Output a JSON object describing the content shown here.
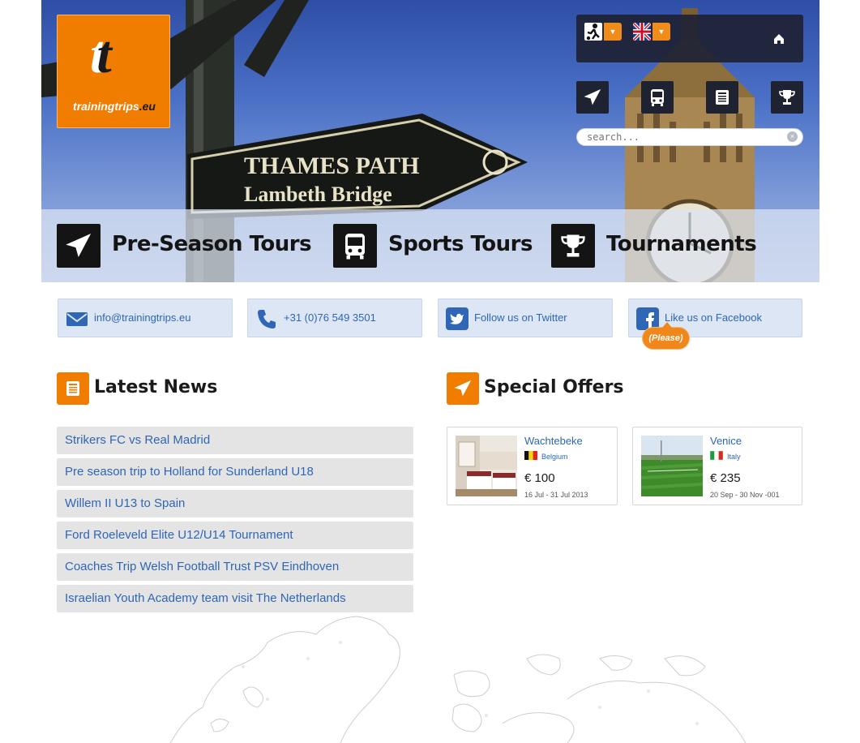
{
  "logo": {
    "mark_first": "t",
    "mark_second": "t",
    "name_prefix": "training",
    "name_accent": "trips",
    "name_suffix": ".eu"
  },
  "header": {
    "sport_selector": {
      "icon": "footballer-icon"
    },
    "language_selector": {
      "icon": "uk-flag-icon"
    },
    "home_icon": "home-icon",
    "nav_tiles": [
      "airplane-icon",
      "bus-icon",
      "newspaper-icon",
      "trophy-icon"
    ],
    "search": {
      "placeholder": "search..."
    },
    "categories": [
      {
        "label": "Pre-Season Tours",
        "icon": "airplane-icon"
      },
      {
        "label": "Sports Tours",
        "icon": "bus-icon"
      },
      {
        "label": "Tournaments",
        "icon": "trophy-icon"
      }
    ]
  },
  "contact": {
    "email": "info@trainingtrips.eu",
    "phone": "+31 (0)76 549 3501",
    "twitter": "Follow us on Twitter",
    "facebook": "Like us on Facebook",
    "facebook_badge": "(Please)"
  },
  "news": {
    "title": "Latest News",
    "items": [
      "Strikers FC vs Real Madrid",
      "Pre season trip to Holland for Sunderland U18",
      "Willem II U13 to Spain",
      "Ford Roeleveld Elite U12/U14 Tournament",
      "Coaches Trip Welsh Football Trust PSV Eindhoven",
      "Israelian Youth Academy team visit The Netherlands"
    ]
  },
  "offers": {
    "title": "Special Offers",
    "items": [
      {
        "name": "Wachtebeke",
        "country": "Belgium",
        "price": "€ 100",
        "dates": "16 Jul - 31 Jul 2013",
        "image": "hotel-room-photo"
      },
      {
        "name": "Venice",
        "country": "Italy",
        "price": "€ 235",
        "dates": "20 Sep - 30 Nov -001",
        "image": "football-pitch-photo"
      }
    ]
  },
  "colors": {
    "accent": "#f07d00",
    "link": "#2f66b6",
    "dark_tile": "#1f2230",
    "contact_bg": "#dde6f4"
  }
}
